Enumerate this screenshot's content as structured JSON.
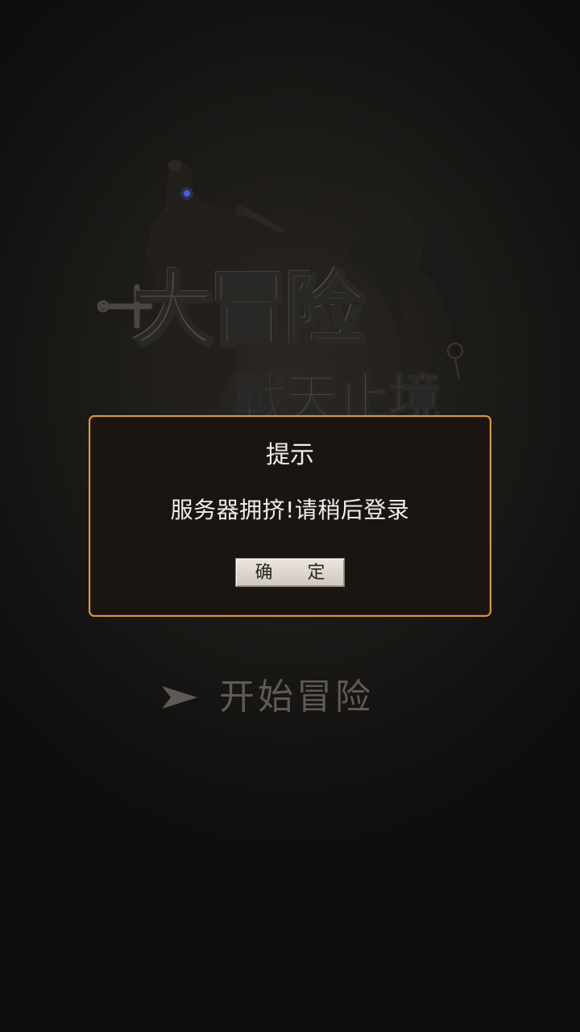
{
  "game": {
    "logo_main": "大冒险",
    "logo_sub": "戰天止境"
  },
  "dialog": {
    "title": "提示",
    "message": "服务器拥挤!请稍后登录",
    "confirm_label": "确 定"
  },
  "menu": {
    "start_label": "开始冒险",
    "start_icon": "arrow-right-icon"
  },
  "colors": {
    "dialog_border": "#d59a3c",
    "dialog_bg": "#1a1511",
    "button_bg": "#e3ddd4",
    "text_light": "#f2efe9",
    "start_text": "#5e5a55"
  }
}
